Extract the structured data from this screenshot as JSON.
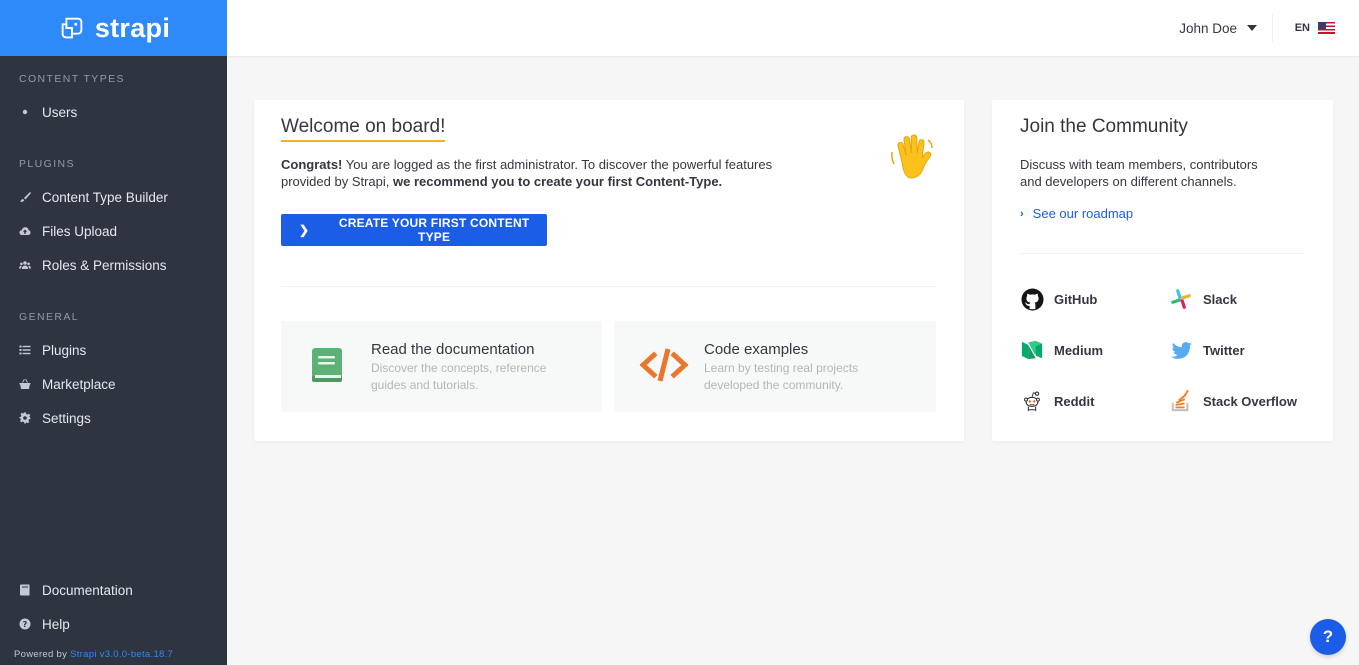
{
  "brand": {
    "name": "strapi"
  },
  "sidebar": {
    "sections": [
      {
        "title": "CONTENT TYPES",
        "items": [
          {
            "label": "Users",
            "icon": "dot-icon"
          }
        ]
      },
      {
        "title": "PLUGINS",
        "items": [
          {
            "label": "Content Type Builder",
            "icon": "paintbrush-icon"
          },
          {
            "label": "Files Upload",
            "icon": "cloud-upload-icon"
          },
          {
            "label": "Roles & Permissions",
            "icon": "users-icon"
          }
        ]
      },
      {
        "title": "GENERAL",
        "items": [
          {
            "label": "Plugins",
            "icon": "list-icon"
          },
          {
            "label": "Marketplace",
            "icon": "shopping-basket-icon"
          },
          {
            "label": "Settings",
            "icon": "gear-icon"
          }
        ]
      }
    ],
    "footer_items": [
      {
        "label": "Documentation",
        "icon": "book-icon"
      },
      {
        "label": "Help",
        "icon": "question-circle-icon"
      }
    ],
    "powered_by": "Powered by",
    "version": "Strapi v3.0.0-beta.18.7"
  },
  "header": {
    "user_name": "John Doe",
    "language": "EN"
  },
  "welcome": {
    "title": "Welcome on board!",
    "intro_bold": "Congrats!",
    "intro_text": " You are logged as the first administrator. To discover the powerful features provided by Strapi, ",
    "intro_emphasis": " we recommend you to create your first Content-Type.",
    "cta_label": "CREATE YOUR FIRST CONTENT TYPE",
    "tiles": [
      {
        "title": "Read the documentation",
        "description": "Discover the concepts, reference guides and tutorials.",
        "icon": "book-icon"
      },
      {
        "title": "Code examples",
        "description": "Learn by testing real projects developed the community.",
        "icon": "code-icon"
      }
    ]
  },
  "community": {
    "title": "Join the Community",
    "description": "Discuss with team members, contributors and developers on different channels.",
    "roadmap_link": "See our roadmap",
    "links": [
      {
        "label": "GitHub",
        "icon": "github-icon"
      },
      {
        "label": "Slack",
        "icon": "slack-icon"
      },
      {
        "label": "Medium",
        "icon": "medium-icon"
      },
      {
        "label": "Twitter",
        "icon": "twitter-icon"
      },
      {
        "label": "Reddit",
        "icon": "reddit-icon"
      },
      {
        "label": "Stack Overflow",
        "icon": "stack-overflow-icon"
      }
    ]
  },
  "help_button": {
    "label": "?"
  },
  "colors": {
    "sidebar_bg": "#2e3440",
    "logo_bg": "#2f8af9",
    "primary": "#1c5de7",
    "underline": "#f0b41e",
    "docs_icon": "#5cb176",
    "code_icon": "#e9772b"
  }
}
